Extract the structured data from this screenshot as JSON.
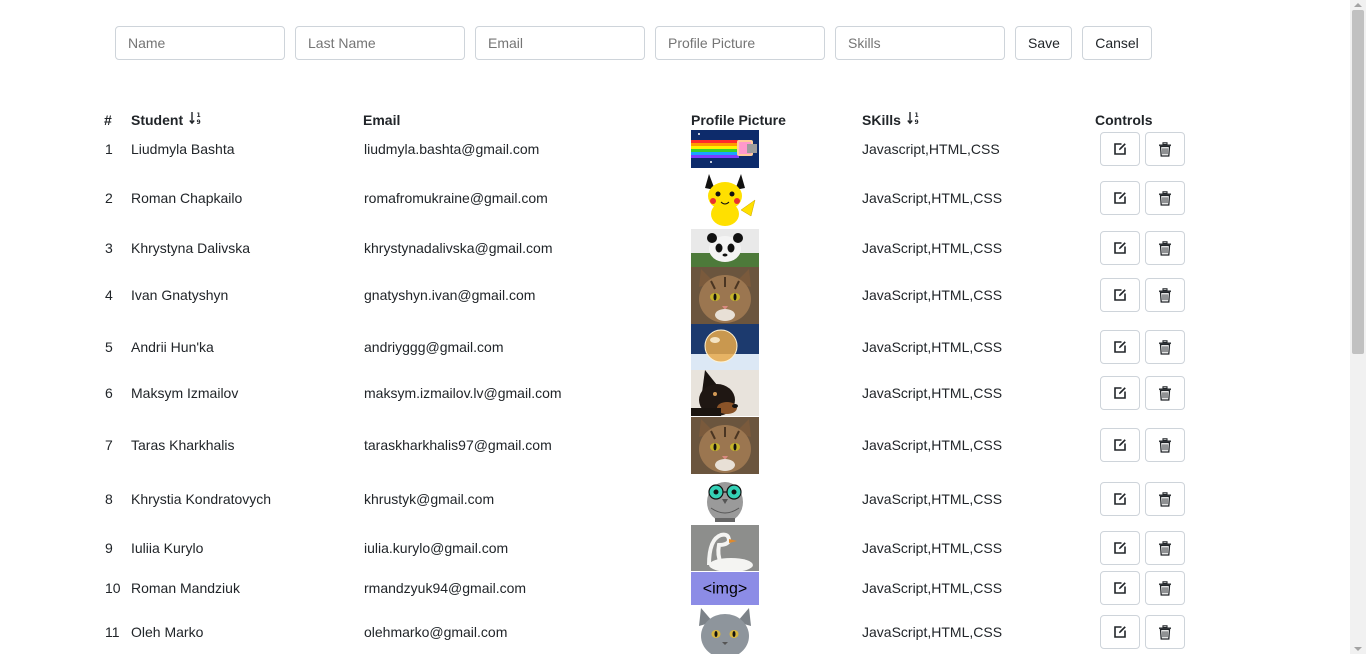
{
  "form": {
    "name_placeholder": "Name",
    "lastname_placeholder": "Last Name",
    "email_placeholder": "Email",
    "picture_placeholder": "Profile Picture",
    "skills_placeholder": "Skills",
    "save_label": "Save",
    "cancel_label": "Cansel"
  },
  "table": {
    "headers": {
      "index": "#",
      "student": "Student",
      "email": "Email",
      "picture": "Profile Picture",
      "skills": "SKills",
      "controls": "Controls"
    },
    "rows": [
      {
        "num": "1",
        "student": "Liudmyla Bashta",
        "email": "liudmyla.bashta@gmail.com",
        "picture": "nyan-cat",
        "skills": "Javascript,HTML,CSS"
      },
      {
        "num": "2",
        "student": "Roman Chapkailo",
        "email": "romafromukraine@gmail.com",
        "picture": "pikachu",
        "skills": "JavaScript,HTML,CSS"
      },
      {
        "num": "3",
        "student": "Khrystyna Dalivska",
        "email": "khrystynadalivska@gmail.com",
        "picture": "panda",
        "skills": "JavaScript,HTML,CSS"
      },
      {
        "num": "4",
        "student": "Ivan Gnatyshyn",
        "email": "gnatyshyn.ivan@gmail.com",
        "picture": "tabby-cat",
        "skills": "JavaScript,HTML,CSS"
      },
      {
        "num": "5",
        "student": "Andrii Hun'ka",
        "email": "andriyggg@gmail.com",
        "picture": "snow-bubble",
        "skills": "JavaScript,HTML,CSS"
      },
      {
        "num": "6",
        "student": "Maksym Izmailov",
        "email": "maksym.izmailov.lv@gmail.com",
        "picture": "doberman",
        "skills": "JavaScript,HTML,CSS"
      },
      {
        "num": "7",
        "student": "Taras Kharkhalis",
        "email": "taraskharkhalis97@gmail.com",
        "picture": "tabby-cat",
        "skills": "JavaScript,HTML,CSS"
      },
      {
        "num": "8",
        "student": "Khrystia Kondratovych",
        "email": "khrustyk@gmail.com",
        "picture": "owl-glasses",
        "skills": "JavaScript,HTML,CSS"
      },
      {
        "num": "9",
        "student": "Iuliia Kurylo",
        "email": "iulia.kurylo@gmail.com",
        "picture": "swan",
        "skills": "JavaScript,HTML,CSS"
      },
      {
        "num": "10",
        "student": "Roman Mandziuk",
        "email": "rmandzyuk94@gmail.com",
        "picture": "img-placeholder",
        "picture_text": "<img>",
        "skills": "JavaScript,HTML,CSS"
      },
      {
        "num": "11",
        "student": "Oleh Marko",
        "email": "olehmarko@gmail.com",
        "picture": "grey-cat",
        "skills": "JavaScript,HTML,CSS"
      }
    ]
  },
  "icons": {
    "edit": "edit-icon",
    "delete": "trash-icon",
    "sort": "sort-numeric-down-icon"
  },
  "colors": {
    "border": "#ced4da",
    "text": "#212529",
    "placeholder_box": "#8c8ce6"
  }
}
